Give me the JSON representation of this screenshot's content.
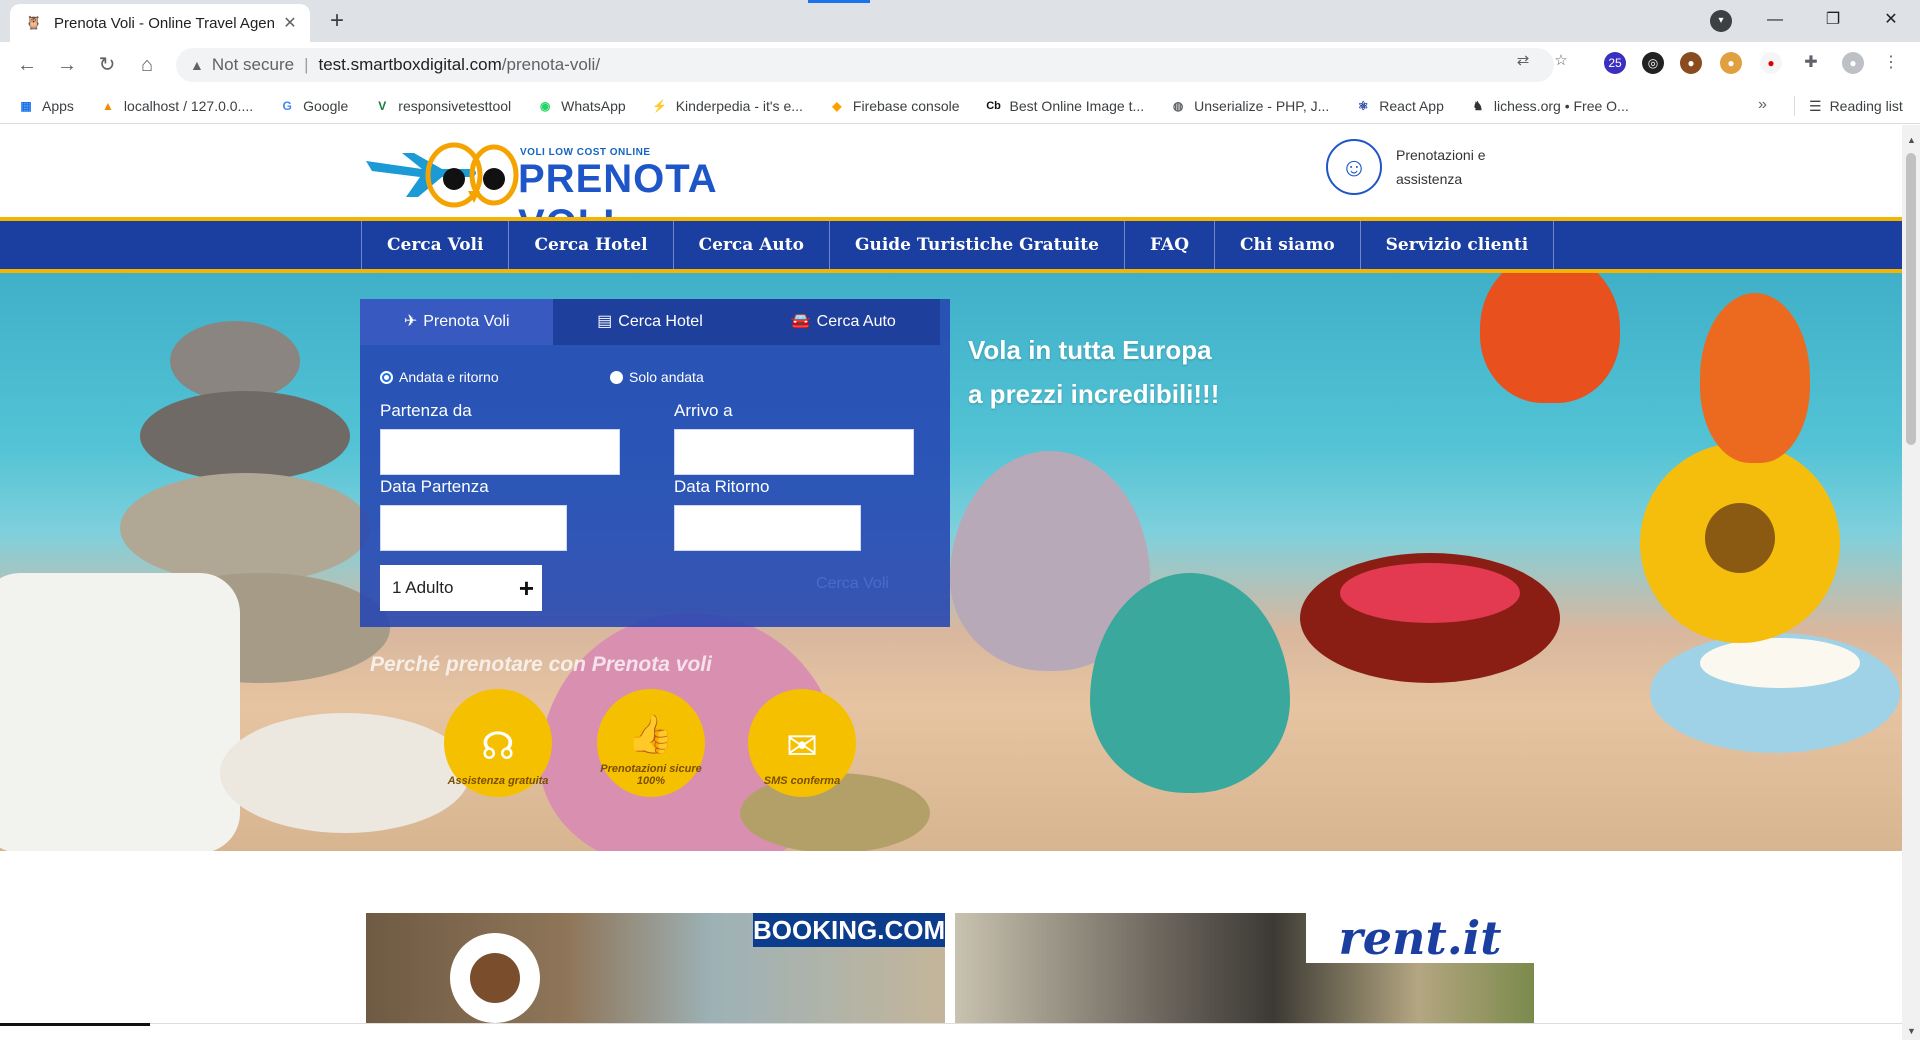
{
  "browser": {
    "tab_title": "Prenota Voli - Online Travel Agen",
    "new_tab_label": "+",
    "omnibox": {
      "security_label": "Not secure",
      "url_host": "test.smartboxdigital.com",
      "url_path": "/prenota-voli/"
    },
    "bookmarks": [
      {
        "label": "Apps",
        "icon": "apps-grid-icon"
      },
      {
        "label": "localhost / 127.0.0....",
        "icon": "phpmyadmin-icon"
      },
      {
        "label": "Google",
        "icon": "google-icon"
      },
      {
        "label": "responsivetesttool",
        "icon": "v-icon"
      },
      {
        "label": "WhatsApp",
        "icon": "whatsapp-icon"
      },
      {
        "label": "Kinderpedia - it's e...",
        "icon": "kinderpedia-icon"
      },
      {
        "label": "Firebase console",
        "icon": "firebase-icon"
      },
      {
        "label": "Best Online Image t...",
        "icon": "cb-icon"
      },
      {
        "label": "Unserialize - PHP, J...",
        "icon": "globe-icon"
      },
      {
        "label": "React App",
        "icon": "react-icon"
      },
      {
        "label": "lichess.org • Free O...",
        "icon": "lichess-icon"
      }
    ],
    "bookmarks_more": "»",
    "reading_list": "Reading list",
    "extension_badge": "25"
  },
  "site": {
    "logo_tagline": "VOLI LOW COST ONLINE",
    "logo_brand": "PRENOTA VOLI",
    "support_text": "Prenotazioni e assistenza",
    "nav": [
      "Cerca Voli",
      "Cerca Hotel",
      "Cerca Auto",
      "Guide Turistiche Gratuite",
      "FAQ",
      "Chi siamo",
      "Servizio clienti"
    ],
    "hero_line1": "Vola in tutta Europa",
    "hero_line2": "a prezzi incredibili!!!",
    "search": {
      "tabs": [
        {
          "label": "Prenota Voli",
          "icon": "plane-icon"
        },
        {
          "label": "Cerca Hotel",
          "icon": "building-icon"
        },
        {
          "label": "Cerca Auto",
          "icon": "car-icon"
        }
      ],
      "radio_roundtrip": "Andata e ritorno",
      "radio_oneway": "Solo andata",
      "from_label": "Partenza da",
      "to_label": "Arrivo a",
      "depart_label": "Data Partenza",
      "return_label": "Data Ritorno",
      "from_value": "",
      "to_value": "",
      "depart_value": "",
      "return_value": "",
      "passengers": "1 Adulto",
      "submit_label": "Cerca Voli"
    },
    "perks_title": "Perché prenotare con Prenota voli",
    "perks": [
      {
        "label": "Assistenza gratuita",
        "icon": "headset-icon"
      },
      {
        "label": "Prenotazioni sicure 100%",
        "icon": "thumbs-up-icon"
      },
      {
        "label": "SMS conferma",
        "icon": "sms-icon"
      }
    ],
    "promo_booking": "BOOKING.COM",
    "promo_rent": "rent.it"
  }
}
